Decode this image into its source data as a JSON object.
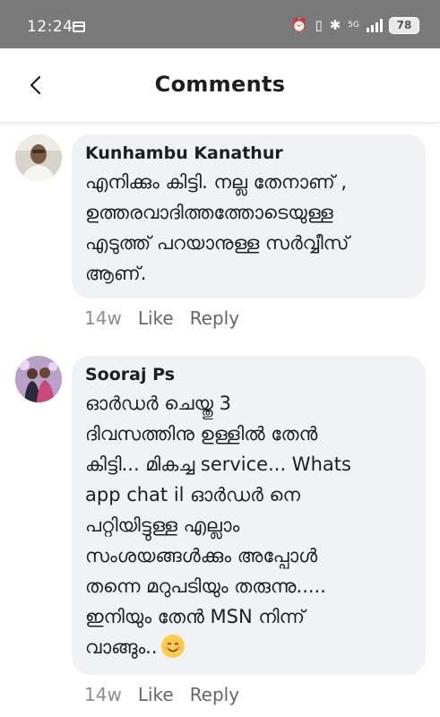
{
  "status_bar": {
    "time": "12:24",
    "network": "5G",
    "battery": "78"
  },
  "header": {
    "title": "Comments"
  },
  "comments": [
    {
      "author": "Kunhambu Kanathur",
      "text": "എനിക്കും കിട്ടി. നല്ല തേനാണ് ,\nഉത്തരവാദിത്തത്തോടെയുള്ള\nഎടുത്ത് പറയാനുള്ള സർവ്വീസ്\nആണ്.",
      "time": "14w",
      "like": "Like",
      "reply": "Reply"
    },
    {
      "author": "Sooraj Ps",
      "text": "ഓർഡർ ചെയ്തു 3\nദിവസത്തിനു ഉള്ളിൽ തേൻ\nകിട്ടി... മികച്ച service... Whats\napp chat il ഓർഡർ നെ\nപറ്റിയിട്ടുള്ള എല്ലാം\nസംശയങ്ങൾക്കും അപ്പോൾ\nതന്നെ മറുപടിയും തരുന്നു.....\nഇനിയും തേൻ MSN നിന്ന്\nവാങ്ങും..",
      "time": "14w",
      "like": "Like",
      "reply": "Reply"
    }
  ],
  "colors": {
    "status_bar_bg": "#7a7a7a",
    "bubble_bg": "#f0f2f5",
    "meta_text": "#65676b"
  }
}
